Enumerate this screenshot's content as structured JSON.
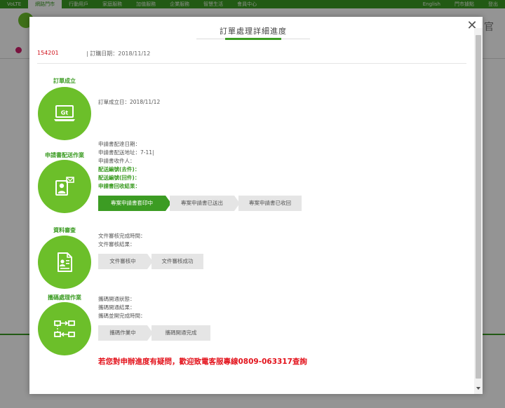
{
  "topnav": {
    "items": [
      "VoLTE",
      "網路門市",
      "行動用戶",
      "家庭服務",
      "加值服務",
      "企業服務",
      "智慧生活",
      "會員中心"
    ],
    "right": [
      "English",
      "門市據點",
      "登出"
    ]
  },
  "bg_header": {
    "right_text": "官"
  },
  "modal": {
    "title": "訂單處理詳細進度",
    "order_no": "154201",
    "order_date": "| 訂購日期：2018/11/12"
  },
  "steps": [
    {
      "title": "訂單成立",
      "icon": "laptop-gt-icon",
      "lines": [
        "訂單成立日：2018/11/12"
      ]
    },
    {
      "title": "申請書配送作業",
      "icon": "person-document-icon",
      "lines": [
        "申請書配達日期：",
        "申請書配送地址：7-11|",
        "申請書收件人："
      ],
      "green_lines": [
        "配送編號(去件)：",
        "配送編號(回件)：",
        "申請書回收結果："
      ],
      "progress": [
        "專案申請書套印中",
        "專案申請書已送出",
        "專案申請書已收回"
      ]
    },
    {
      "title": "資料審查",
      "icon": "document-review-icon",
      "lines": [
        "文件審核完成時間：",
        "文件審核結果："
      ],
      "progress": [
        "文件審核中",
        "文件審核成功"
      ]
    },
    {
      "title": "攜碼處理作業",
      "icon": "number-transfer-icon",
      "lines": [
        "攜碼開通狀態：",
        "攜碼開通結果：",
        "攜碼並開完成時間："
      ],
      "progress": [
        "攜碼作業中",
        "攜碼開通完成"
      ]
    }
  ],
  "notice": "若您對申辦進度有疑問，歡迎致電客服專線0809-063317查詢",
  "colors": {
    "accent": "#3c9c23",
    "circle": "#6cbf2a",
    "alert": "#e3131c"
  }
}
